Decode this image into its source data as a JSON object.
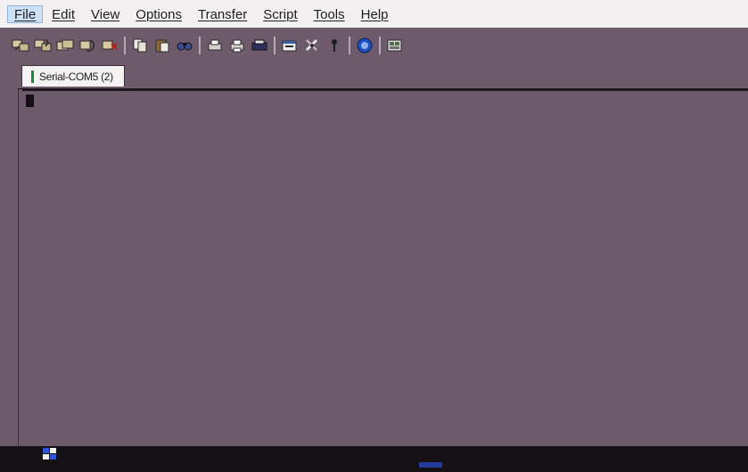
{
  "menu": {
    "items": [
      {
        "label": "File",
        "active": true
      },
      {
        "label": "Edit",
        "active": false
      },
      {
        "label": "View",
        "active": false
      },
      {
        "label": "Options",
        "active": false
      },
      {
        "label": "Transfer",
        "active": false
      },
      {
        "label": "Script",
        "active": false
      },
      {
        "label": "Tools",
        "active": false
      },
      {
        "label": "Help",
        "active": false
      }
    ]
  },
  "toolbar": {
    "buttons": [
      {
        "icon": "connect-icon"
      },
      {
        "icon": "quick-connect-icon"
      },
      {
        "icon": "connect-in-tab-icon"
      },
      {
        "icon": "reconnect-icon"
      },
      {
        "icon": "disconnect-icon"
      },
      {
        "icon": "separator"
      },
      {
        "icon": "copy-icon"
      },
      {
        "icon": "paste-icon"
      },
      {
        "icon": "find-icon"
      },
      {
        "icon": "separator"
      },
      {
        "icon": "print-setup-icon"
      },
      {
        "icon": "print-icon"
      },
      {
        "icon": "print-screen-icon"
      },
      {
        "icon": "separator"
      },
      {
        "icon": "session-options-icon"
      },
      {
        "icon": "global-options-icon"
      },
      {
        "icon": "keymap-icon"
      },
      {
        "icon": "separator"
      },
      {
        "icon": "help-icon"
      },
      {
        "icon": "separator"
      },
      {
        "icon": "sftp-icon"
      }
    ]
  },
  "tabs": [
    {
      "label": "Serial-COM5 (2)",
      "status_color": "#1d8a3a",
      "active": true
    }
  ],
  "colors": {
    "menubar_bg": "#f2f0f1",
    "window_bg": "#6d5b6c",
    "terminal_bg": "#6d5b6c",
    "cursor": "#141014",
    "taskbar_bg": "#141014",
    "tab_status": "#1d8a3a"
  }
}
